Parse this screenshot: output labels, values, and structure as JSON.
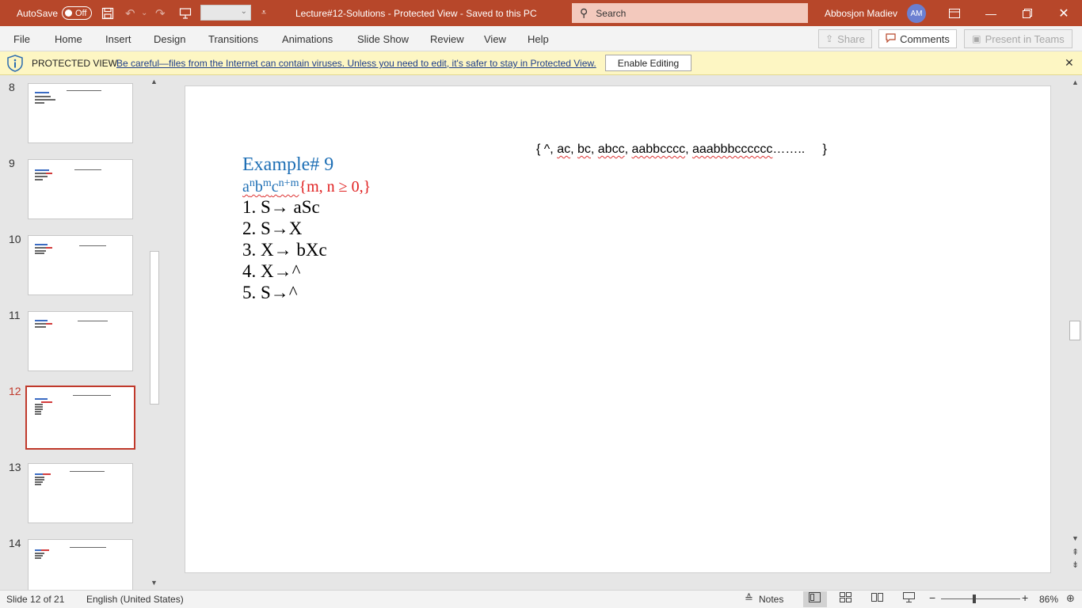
{
  "titlebar": {
    "autosave_label": "AutoSave",
    "autosave_state": "Off",
    "document_title": "Lecture#12-Solutions  -  Protected View  -  Saved to this PC",
    "search_placeholder": "Search",
    "user_name": "Abbosjon Madiev",
    "user_initials": "AM"
  },
  "ribbon": {
    "tabs": [
      "File",
      "Home",
      "Insert",
      "Design",
      "Transitions",
      "Animations",
      "Slide Show",
      "Review",
      "View",
      "Help"
    ],
    "share_label": "Share",
    "comments_label": "Comments",
    "present_label": "Present in Teams"
  },
  "protected_view": {
    "title": "PROTECTED VIEW",
    "message": "Be careful—files from the Internet can contain viruses. Unless you need to edit, it's safer to stay in Protected View.",
    "enable_button": "Enable Editing"
  },
  "thumbnails": [
    {
      "number": "8",
      "active": false
    },
    {
      "number": "9",
      "active": false
    },
    {
      "number": "10",
      "active": false
    },
    {
      "number": "11",
      "active": false
    },
    {
      "number": "12",
      "active": true
    },
    {
      "number": "13",
      "active": false
    },
    {
      "number": "14",
      "active": false
    }
  ],
  "slide": {
    "set_open": "{ ^, ",
    "set_items": [
      "ac",
      "bc",
      "abcc",
      "aabbcccc",
      "aaabbbcccccc"
    ],
    "set_close": "……..     }",
    "example_title": "Example# 9",
    "language": {
      "a": "a",
      "a_exp": "n",
      "b": "b",
      "b_exp": "m",
      "c": "c",
      "c_exp": "n+m",
      "condition": "{m, n ≥ 0,}"
    },
    "rules": [
      "1. S→ aSc",
      "2. S→X",
      "3. X→ bXc",
      "4. X→^",
      "5. S→^"
    ]
  },
  "statusbar": {
    "slide_info": "Slide 12 of 21",
    "language": "English (United States)",
    "notes_label": "Notes",
    "zoom": "86%"
  },
  "colors": {
    "titlebar": "#b7472a",
    "protected_bar": "#fdf6c3",
    "accent_red": "#c0392b",
    "example_blue": "#1e6fb5",
    "condition_red": "#e02020"
  }
}
